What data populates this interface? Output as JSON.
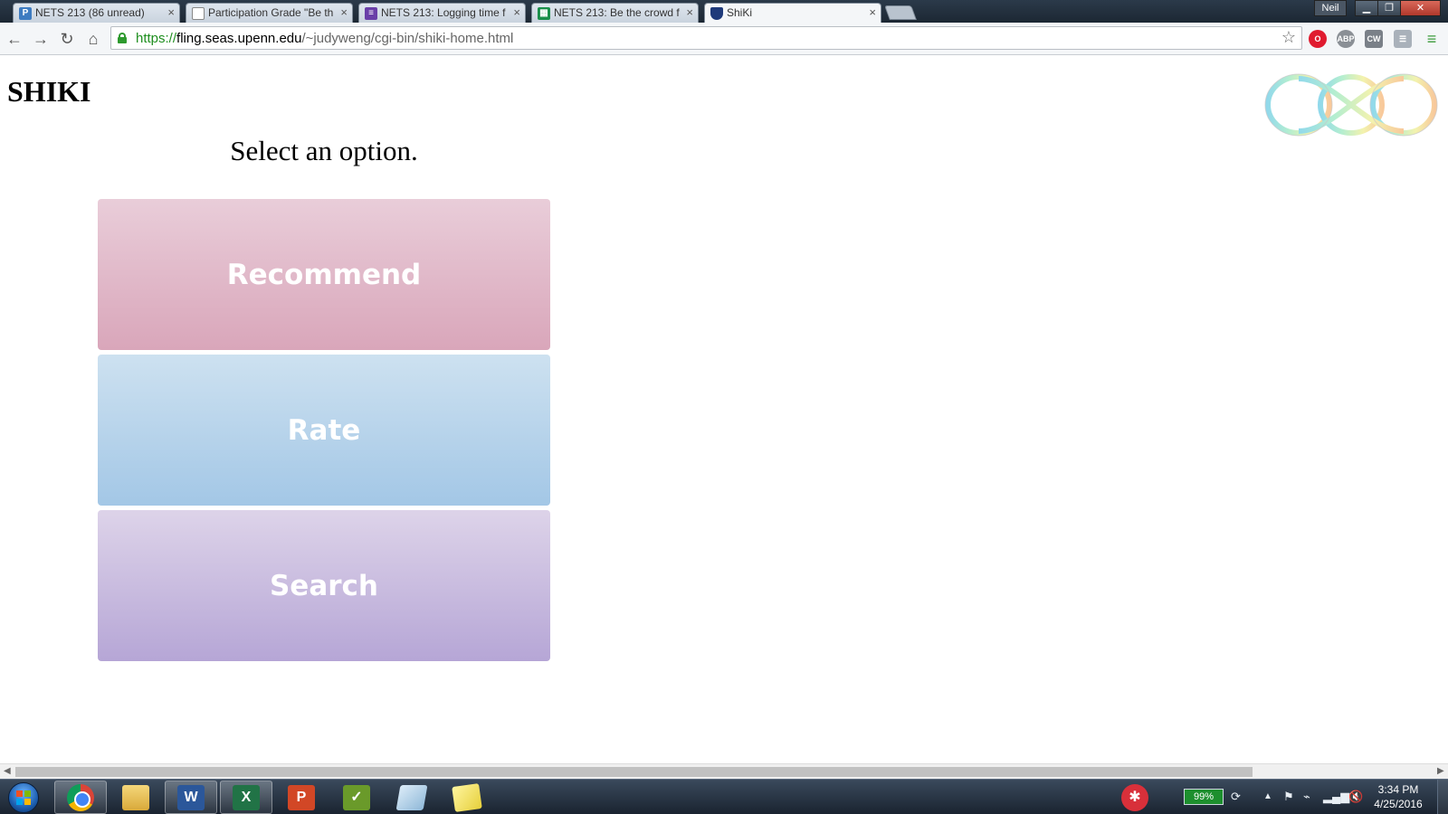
{
  "browser": {
    "tabs": [
      {
        "title": "NETS 213 (86 unread)",
        "favicon": "piazza-icon",
        "favicon_color": "#3e7cc1",
        "favicon_text": "P",
        "active": false
      },
      {
        "title": "Participation Grade \"Be th",
        "favicon": "document-icon",
        "favicon_color": "#ffffff",
        "favicon_text": "",
        "active": false
      },
      {
        "title": "NETS 213: Logging time f",
        "favicon": "forms-icon",
        "favicon_color": "#6a3fa8",
        "favicon_text": "≡",
        "active": false
      },
      {
        "title": "NETS 213: Be the crowd f",
        "favicon": "sheets-icon",
        "favicon_color": "#1a8f4a",
        "favicon_text": "▦",
        "active": false
      },
      {
        "title": "ShiKi",
        "favicon": "penn-shield-icon",
        "favicon_color": "#1f3a7a",
        "favicon_text": "",
        "active": true
      }
    ],
    "profile_name": "Neil",
    "url": {
      "scheme": "https://",
      "host": "fling.seas.upenn.edu",
      "path": "/~judyweng/cgi-bin/shiki-home.html"
    },
    "extensions": [
      {
        "name": "opera-icon",
        "label": "O",
        "color": "#e01b2f"
      },
      {
        "name": "adblock-icon",
        "label": "ABP",
        "color": "#8a8f95"
      },
      {
        "name": "cw-extension-icon",
        "label": "CW",
        "color": "#7a8088"
      },
      {
        "name": "reader-extension-icon",
        "label": "☰",
        "color": "#a9b1ba"
      },
      {
        "name": "menu-icon",
        "label": "≡",
        "color": "#3a9a3a"
      }
    ]
  },
  "page": {
    "site_title": "SHIKI",
    "prompt": "Select an option.",
    "buttons": {
      "recommend": "Recommend",
      "rate": "Rate",
      "search": "Search"
    },
    "logo_colors": [
      "#7fd3e8",
      "#a8ecc8",
      "#f2f0a0",
      "#f7c08a"
    ]
  },
  "taskbar": {
    "apps": [
      {
        "name": "chrome-icon",
        "active": true
      },
      {
        "name": "file-explorer-icon",
        "label": "",
        "color": "#e8c35a"
      },
      {
        "name": "word-icon",
        "label": "W",
        "color": "#2b579a"
      },
      {
        "name": "excel-icon",
        "label": "X",
        "color": "#217346"
      },
      {
        "name": "powerpoint-icon",
        "label": "P",
        "color": "#d24726"
      },
      {
        "name": "project-icon",
        "label": "✓",
        "color": "#6a9a2a"
      },
      {
        "name": "notepad-icon",
        "label": "",
        "color": "#8fb8d8"
      },
      {
        "name": "sticky-notes-icon",
        "label": "",
        "color": "#f2e36a"
      }
    ],
    "battery_percent": "99%",
    "clock_time": "3:34 PM",
    "clock_date": "4/25/2016"
  }
}
